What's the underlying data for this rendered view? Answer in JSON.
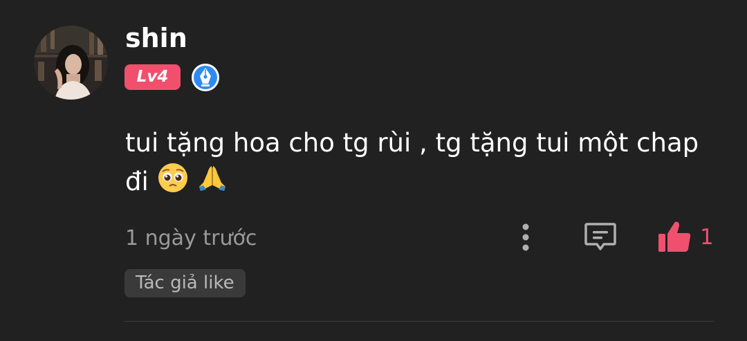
{
  "user": {
    "name": "shin",
    "level": "Lv4",
    "avatar_icon": "user-photo-avatar",
    "badge_icon": "pen-nib-icon"
  },
  "comment": {
    "text": "tui tặng hoa cho tg rùi , tg tặng tui một chap đi",
    "emojis": [
      "pleading-face-emoji",
      "folded-hands-emoji"
    ],
    "timestamp": "1 ngày trước",
    "like_count": "1",
    "author_like_tag": "Tác giả like"
  },
  "actions": {
    "more_icon": "more-vertical-icon",
    "reply_icon": "comment-reply-icon",
    "like_icon": "thumbs-up-icon"
  },
  "colors": {
    "background": "#212121",
    "accent": "#f0506e",
    "badge_blue": "#2f8bf2",
    "muted_text": "#9a9a9a"
  }
}
